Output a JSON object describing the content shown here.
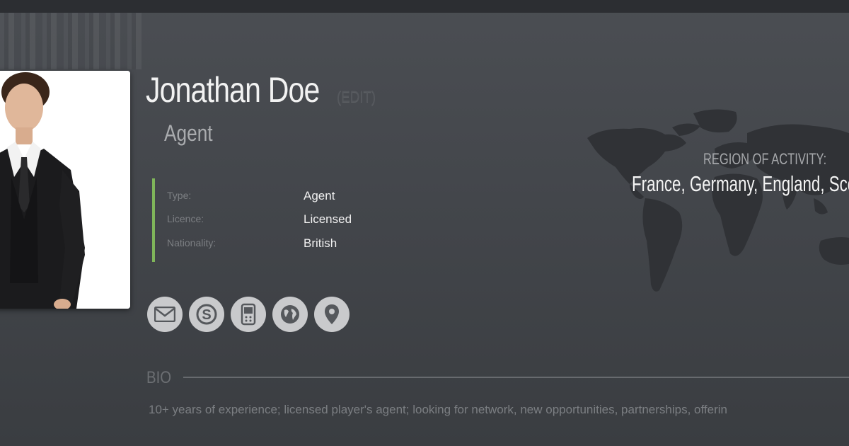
{
  "profile": {
    "name": "Jonathan Doe",
    "edit_label": "(EDIT)",
    "role": "Agent"
  },
  "details": [
    {
      "label": "Type:",
      "value": "Agent"
    },
    {
      "label": "Licence:",
      "value": "Licensed"
    },
    {
      "label": "Nationality:",
      "value": "British"
    }
  ],
  "contact_icons": [
    "envelope-icon",
    "skype-icon",
    "mobile-phone-icon",
    "globe-icon",
    "map-pin-icon"
  ],
  "region": {
    "label": "REGION OF ACTIVITY:",
    "value": "France, Germany, England, Sco"
  },
  "bio": {
    "label": "BIO",
    "text": "10+ years of experience; licensed player's agent; looking for network, new opportunities, partnerships, offerin"
  },
  "colors": {
    "accent_bar": "#7fb55a",
    "background": "#46494e",
    "icon_bg": "#c9cacc"
  }
}
